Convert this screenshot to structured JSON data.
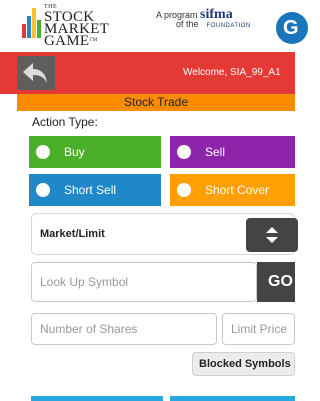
{
  "header": {
    "logo": {
      "the": "THE",
      "line1": "STOCK",
      "line2": "MARKET",
      "line3": "GAME",
      "tm": "TM"
    },
    "sponsor": {
      "prefix": "A program",
      "brand": "sifma",
      "of_the": "of the",
      "foundation": "FOUNDATION"
    },
    "partner_logo_letter": "G"
  },
  "navbar": {
    "back_icon": "back-arrow-icon",
    "welcome": "Welcome, SIA_99_A1"
  },
  "title": "Stock Trade",
  "form": {
    "action_type_label": "Action Type:",
    "actions": [
      {
        "label": "Buy",
        "color": "#4caf2a"
      },
      {
        "label": "Sell",
        "color": "#8e24aa"
      },
      {
        "label": "Short Sell",
        "color": "#1e88c8"
      },
      {
        "label": "Short Cover",
        "color": "#ffa000"
      }
    ],
    "order_type": {
      "selected": "Market/Limit",
      "icon": "sort-arrows-icon"
    },
    "symbol": {
      "placeholder": "Look Up Symbol",
      "go_label": "GO"
    },
    "shares": {
      "placeholder": "Number of Shares"
    },
    "limit_price": {
      "placeholder": "Limit Price"
    },
    "blocked_symbols_label": "Blocked Symbols"
  },
  "colors": {
    "navbar": "#e53935",
    "title_bar": "#fb8c00",
    "dark_button": "#444444"
  }
}
